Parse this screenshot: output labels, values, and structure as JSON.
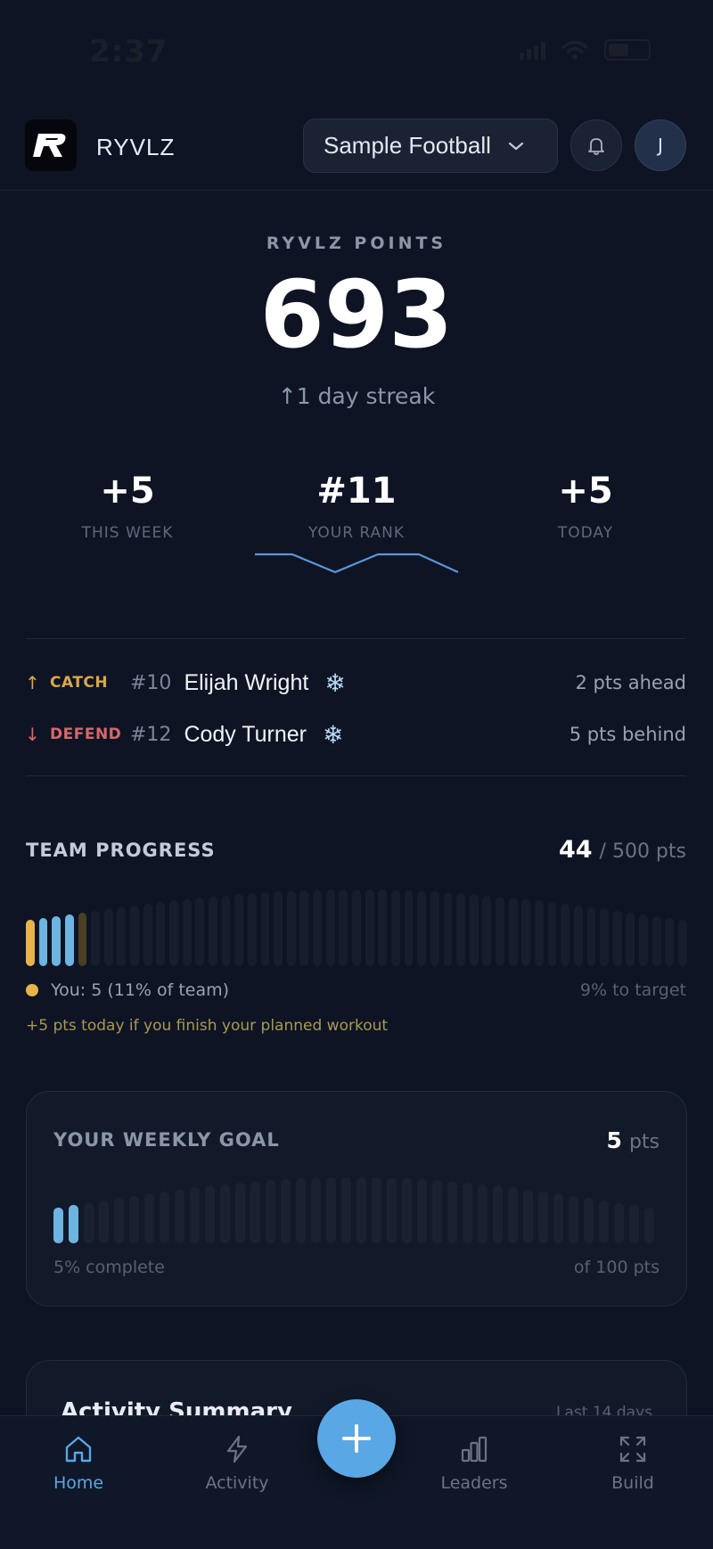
{
  "status_bar": {
    "time": "2:37"
  },
  "header": {
    "brand": "RYVLZ",
    "team_selector": "Sample Football",
    "avatar_initial": "J"
  },
  "points": {
    "label": "RYVLZ POINTS",
    "value": "693",
    "streak": "↑1 day streak"
  },
  "stats": [
    {
      "value": "+5",
      "label": "THIS WEEK"
    },
    {
      "value": "#11",
      "label": "YOUR RANK"
    },
    {
      "value": "+5",
      "label": "TODAY"
    }
  ],
  "rivals": [
    {
      "arrow": "↑",
      "tag": "CATCH",
      "rank": "#10",
      "name": "Elijah Wright",
      "gap": "2 pts ahead",
      "color": "#d9a74a"
    },
    {
      "arrow": "↓",
      "tag": "DEFEND",
      "rank": "#12",
      "name": "Cody Turner",
      "gap": "5 pts behind",
      "color": "#d7676b"
    }
  ],
  "team_progress": {
    "title": "TEAM PROGRESS",
    "current": "44",
    "total_suffix": "/ 500 pts",
    "you_text": "You: 5 (11% of team)",
    "target_text": "9% to target",
    "hint": "+5 pts today if you finish your planned workout",
    "you_color": "#e8b44a",
    "team_color": "#6db4e0",
    "filled_bars": 5
  },
  "weekly_goal": {
    "title": "YOUR WEEKLY GOAL",
    "points": "5",
    "unit": "pts",
    "complete": "5% complete",
    "of_total": "of 100 pts",
    "percent": 5
  },
  "activity_summary": {
    "title": "Activity Summary",
    "range": "Last 14 days"
  },
  "bottom_nav": [
    {
      "label": "Home",
      "icon": "home-icon",
      "active": true
    },
    {
      "label": "Activity",
      "icon": "lightning-icon",
      "active": false
    },
    {
      "label": "Leaders",
      "icon": "bar-chart-icon",
      "active": false
    },
    {
      "label": "Build",
      "icon": "expand-icon",
      "active": false
    }
  ],
  "colors": {
    "accent": "#5aa7e6",
    "background": "#0e1424",
    "catch": "#d9a74a",
    "defend": "#d7676b"
  }
}
